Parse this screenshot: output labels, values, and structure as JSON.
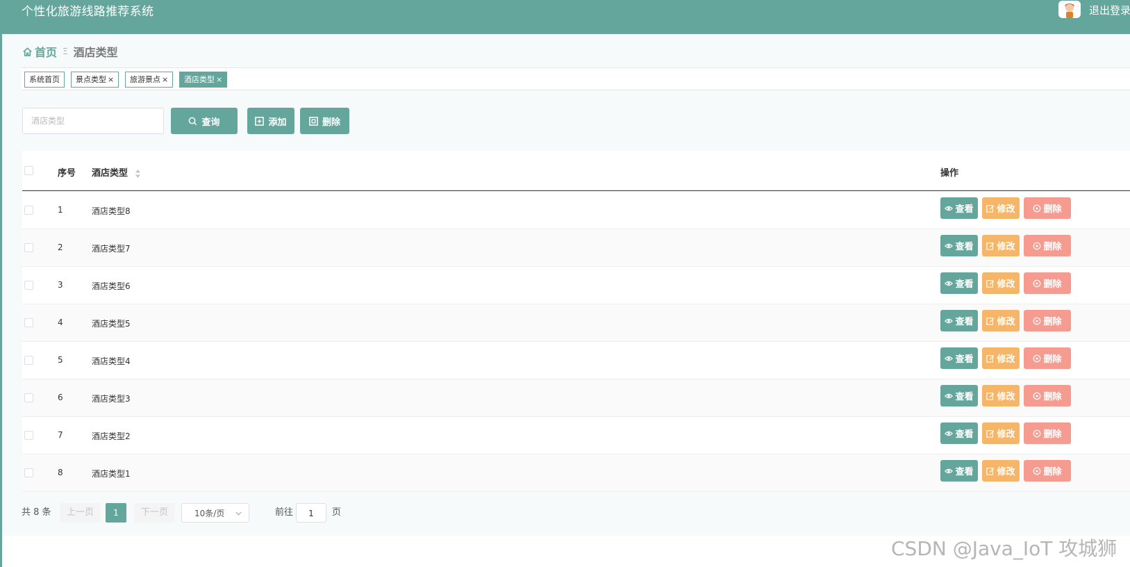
{
  "header": {
    "app_title": "个性化旅游线路推荐系统",
    "logout_label": "退出登录"
  },
  "breadcrumb": {
    "home": "首页",
    "separator": "Ξ",
    "current": "酒店类型"
  },
  "tags": [
    {
      "label": "系统首页",
      "closable": false
    },
    {
      "label": "景点类型",
      "closable": true
    },
    {
      "label": "旅游景点",
      "closable": true
    },
    {
      "label": "酒店类型",
      "closable": true,
      "active": true
    }
  ],
  "tag_close": "×",
  "toolbar": {
    "search_placeholder": "酒店类型",
    "search_value": "",
    "query_label": "查询",
    "add_label": "添加",
    "delete_label": "删除"
  },
  "table": {
    "headers": {
      "index": "序号",
      "type": "酒店类型",
      "actions": "操作"
    },
    "rows": [
      {
        "index": "1",
        "type": "酒店类型8"
      },
      {
        "index": "2",
        "type": "酒店类型7"
      },
      {
        "index": "3",
        "type": "酒店类型6"
      },
      {
        "index": "4",
        "type": "酒店类型5"
      },
      {
        "index": "5",
        "type": "酒店类型4"
      },
      {
        "index": "6",
        "type": "酒店类型3"
      },
      {
        "index": "7",
        "type": "酒店类型2"
      },
      {
        "index": "8",
        "type": "酒店类型1"
      }
    ],
    "row_actions": {
      "view": "查看",
      "edit": "修改",
      "delete": "删除"
    }
  },
  "pagination": {
    "total": "共 8 条",
    "prev": "上一页",
    "current_page": "1",
    "next": "下一页",
    "page_size": "10条/页",
    "goto_label": "前往",
    "goto_value": "1",
    "page_suffix": "页"
  },
  "watermark": "CSDN @Java_IoT 攻城狮",
  "colors": {
    "primary": "#64a69b",
    "edit": "#f6b66a",
    "danger": "#f59b90"
  },
  "icons": {
    "home": "home-icon",
    "search": "search-icon",
    "add": "plus-square-icon",
    "delete": "minus-square-icon",
    "view": "eye-icon",
    "edit": "edit-icon",
    "row_delete": "close-circle-icon",
    "sort": "sort-icon",
    "dropdown": "chevron-down-icon",
    "cursor": "hand-cursor-icon"
  }
}
